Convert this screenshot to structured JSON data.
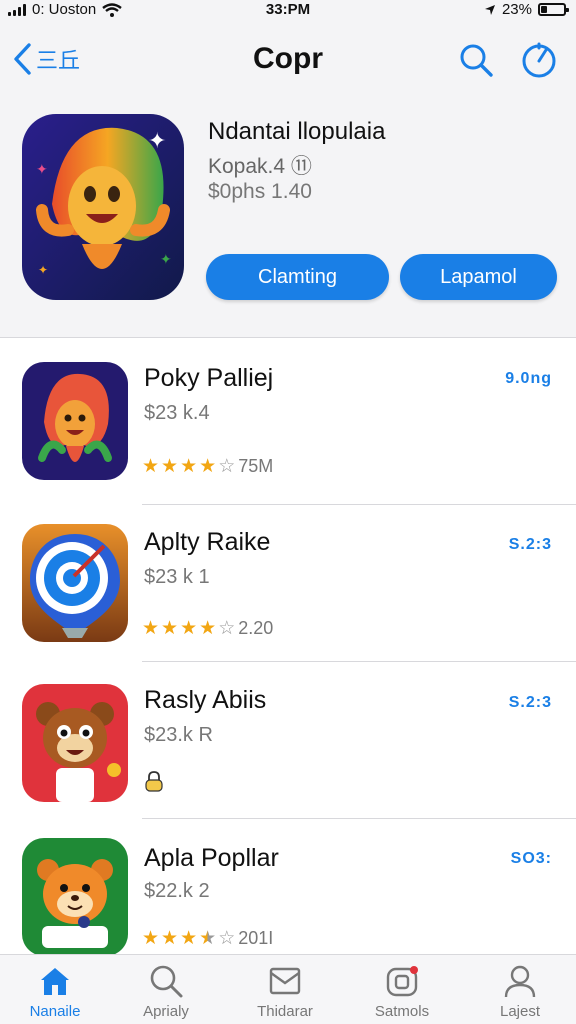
{
  "status_bar": {
    "carrier": "0: Uoston",
    "time": "33:PM",
    "battery": "23%"
  },
  "nav": {
    "back_label": "三丘",
    "title": "Copr",
    "icons": [
      "chevron-left-icon",
      "search-icon",
      "compass-icon"
    ]
  },
  "featured": {
    "title": "Ndantai llopulaia",
    "subtitle": "Kopak.4  ⑪",
    "price": "$0phs 1.40",
    "primary_button": "Clamting",
    "secondary_button": "Lapamol"
  },
  "apps": [
    {
      "name": "Poky Palliej",
      "price": "$23 k.4",
      "rating": 4,
      "rating_count": "75M",
      "action": "9.0ng",
      "icon": "mascot-flame-icon"
    },
    {
      "name": "Aplty Raike",
      "price": "$23 k 1",
      "rating": 4,
      "rating_count": "2.20",
      "action": "S.2:3",
      "icon": "target-pin-icon"
    },
    {
      "name": "Rasly Abiis",
      "price": "$23.k R",
      "rating": null,
      "rating_count": "",
      "action": "S.2:3",
      "icon": "bear-mascot-icon"
    },
    {
      "name": "Apla Popllar",
      "price": "$22.k 2",
      "rating": 3.5,
      "rating_count": "201I",
      "action": "SO3:",
      "icon": "fox-mascot-icon"
    }
  ],
  "tab_bar": {
    "items": [
      {
        "label": "Nanaile",
        "icon": "home-icon",
        "active": true
      },
      {
        "label": "Aprialy",
        "icon": "search-icon",
        "active": false
      },
      {
        "label": "Thidarar",
        "icon": "inbox-icon",
        "active": false
      },
      {
        "label": "Satmols",
        "icon": "games-icon",
        "active": false
      },
      {
        "label": "Lajest",
        "icon": "person-icon",
        "active": false
      }
    ]
  },
  "colors": {
    "accent": "#1a7fe6",
    "star": "#f2a613",
    "header_bg": "#f4f4f6"
  }
}
